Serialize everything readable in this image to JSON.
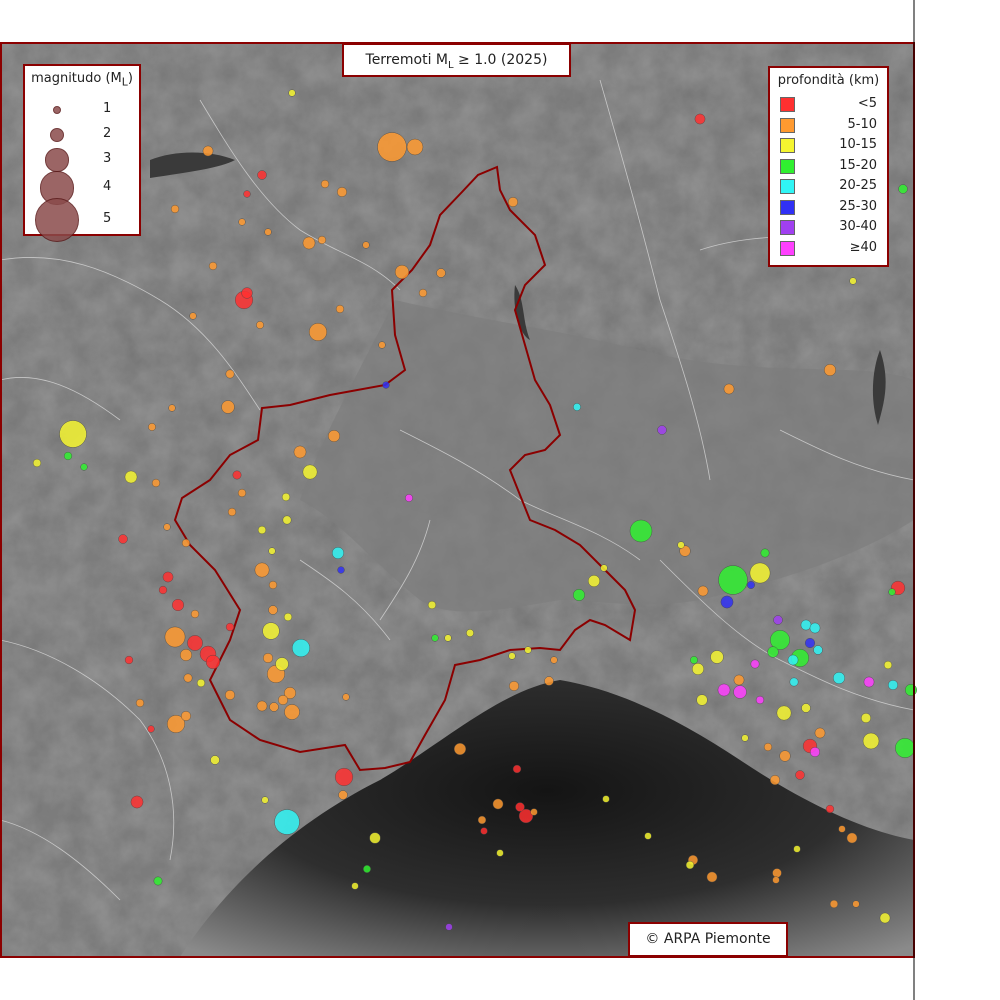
{
  "title": {
    "prefix": "Terremoti M",
    "sub": "L",
    "suffix": " ≥ 1.0 (2025)"
  },
  "magnitude_legend": {
    "title_prefix": "magnitudo (M",
    "title_sub": "L",
    "title_suffix": ")",
    "items": [
      {
        "label": "1",
        "ml": 1
      },
      {
        "label": "2",
        "ml": 2
      },
      {
        "label": "3",
        "ml": 3
      },
      {
        "label": "4",
        "ml": 4
      },
      {
        "label": "5",
        "ml": 5
      }
    ]
  },
  "depth_legend": {
    "title": "profondità (km)",
    "items": [
      {
        "label": "<5",
        "color": "#ff3030"
      },
      {
        "label": "5-10",
        "color": "#ff9a30"
      },
      {
        "label": "10-15",
        "color": "#f5f530"
      },
      {
        "label": "15-20",
        "color": "#30f030"
      },
      {
        "label": "20-25",
        "color": "#30f5f5"
      },
      {
        "label": "25-30",
        "color": "#3030f5"
      },
      {
        "label": "30-40",
        "color": "#a040f0"
      },
      {
        "label": "≥40",
        "color": "#ff40ff"
      }
    ]
  },
  "credit": "© ARPA Piemonte",
  "colors": {
    "frame": "#8b0000",
    "region_border": "#8b0000",
    "land": "#6e6e6e",
    "sea_deep": "#151515"
  }
}
